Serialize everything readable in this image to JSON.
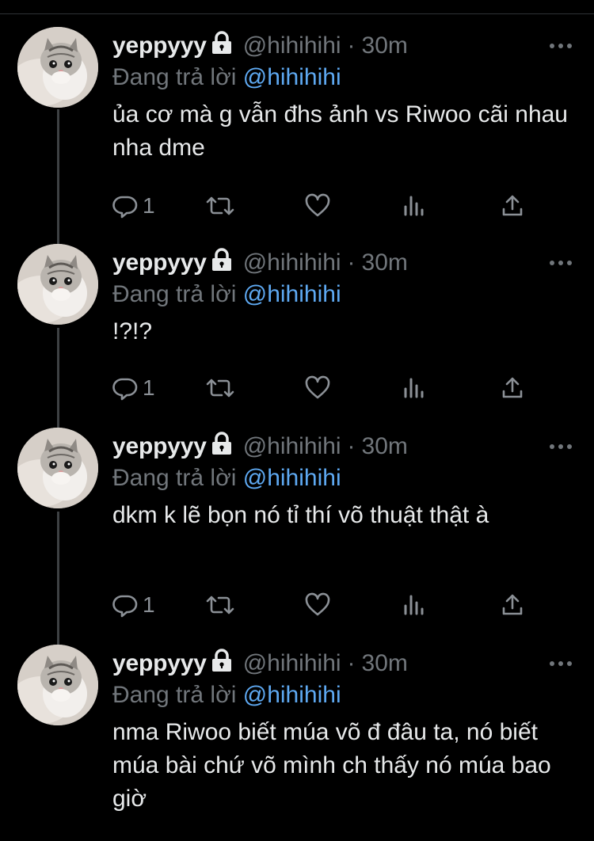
{
  "colors": {
    "background": "#000000",
    "text": "#e7e9ea",
    "muted": "#71767b",
    "mention": "#5ea9f2",
    "thread_line": "#3e4144"
  },
  "tweets": [
    {
      "display_name": "yeppyyy",
      "handle": "@hihihihi",
      "separator": "·",
      "time": "30m",
      "replying_prefix": "Đang trả lời",
      "replying_to": "@hihihihi",
      "text": "ủa cơ mà g vẫn đhs ảnh vs Riwoo cãi nhau nha dme",
      "reply_count": "1",
      "icons": [
        "lock-icon",
        "more-icon",
        "reply-icon",
        "retweet-icon",
        "like-icon",
        "analytics-icon",
        "share-icon"
      ]
    },
    {
      "display_name": "yeppyyy",
      "handle": "@hihihihi",
      "separator": "·",
      "time": "30m",
      "replying_prefix": "Đang trả lời",
      "replying_to": "@hihihihi",
      "text": "!?!?",
      "reply_count": "1",
      "icons": [
        "lock-icon",
        "more-icon",
        "reply-icon",
        "retweet-icon",
        "like-icon",
        "analytics-icon",
        "share-icon"
      ]
    },
    {
      "display_name": "yeppyyy",
      "handle": "@hihihihi",
      "separator": "·",
      "time": "30m",
      "replying_prefix": "Đang trả lời",
      "replying_to": "@hihihihi",
      "text": "dkm k lẽ bọn nó tỉ thí võ thuật thật à",
      "reply_count": "1",
      "icons": [
        "lock-icon",
        "more-icon",
        "reply-icon",
        "retweet-icon",
        "like-icon",
        "analytics-icon",
        "share-icon"
      ]
    },
    {
      "display_name": "yeppyyy",
      "handle": "@hihihihi",
      "separator": "·",
      "time": "30m",
      "replying_prefix": "Đang trả lời",
      "replying_to": "@hihihihi",
      "text": "nma Riwoo biết múa võ đ đâu ta, nó biết múa bài chứ võ mình ch thấy nó múa bao giờ",
      "icons": [
        "lock-icon",
        "more-icon"
      ]
    }
  ]
}
